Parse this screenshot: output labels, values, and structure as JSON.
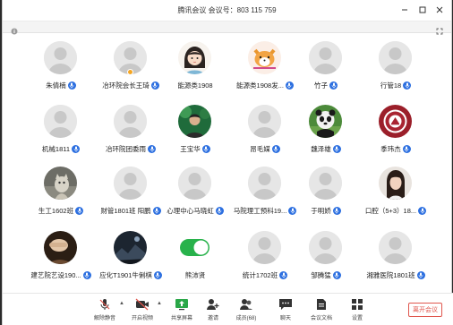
{
  "window": {
    "title": "腾讯会议  会议号：803 115 759"
  },
  "participants": [
    {
      "name": "朱倩楠",
      "avatar": "default",
      "mic": true
    },
    {
      "name": "冶环院会长王琦",
      "avatar": "default",
      "mic": true,
      "host": true
    },
    {
      "name": "能源类1908",
      "avatar": "girl-cartoon",
      "mic": false
    },
    {
      "name": "能源类1908发...",
      "avatar": "corgi-cartoon",
      "mic": true
    },
    {
      "name": "竹子",
      "avatar": "default",
      "mic": true
    },
    {
      "name": "行管18",
      "avatar": "default",
      "mic": true
    },
    {
      "name": "机械1811",
      "avatar": "default",
      "mic": true
    },
    {
      "name": "冶环院团委雨",
      "avatar": "default",
      "mic": true
    },
    {
      "name": "王宝华",
      "avatar": "person-green",
      "mic": true
    },
    {
      "name": "昂毛媒",
      "avatar": "default",
      "mic": true
    },
    {
      "name": "魏泽雄",
      "avatar": "panda",
      "mic": true
    },
    {
      "name": "季玮杰",
      "avatar": "badge-logo",
      "mic": true
    },
    {
      "name": "生工1602班",
      "avatar": "cat-photo",
      "mic": true
    },
    {
      "name": "财管1801班 阳鹏",
      "avatar": "default",
      "mic": true
    },
    {
      "name": "心理中心马晓虹",
      "avatar": "default",
      "mic": true
    },
    {
      "name": "马院理工预科19...",
      "avatar": "default",
      "mic": true
    },
    {
      "name": "于明娇",
      "avatar": "default",
      "mic": true
    },
    {
      "name": "口腔（5+3）18...",
      "avatar": "woman-photo",
      "mic": true
    },
    {
      "name": "建艺院艺设190...",
      "avatar": "hand-photo",
      "mic": true
    },
    {
      "name": "应化T1901牛俐棋",
      "avatar": "dark-photo",
      "mic": true
    },
    {
      "name": "熊沛贤",
      "avatar": "toggle",
      "mic": false
    },
    {
      "name": "统计1702班",
      "avatar": "default",
      "mic": true
    },
    {
      "name": "邹腾猛",
      "avatar": "default",
      "mic": true
    },
    {
      "name": "湘雅医院1801班",
      "avatar": "default",
      "mic": true
    }
  ],
  "toolbar": {
    "mute": "解除静音",
    "video": "开启视频",
    "share": "共享屏幕",
    "invite": "邀请",
    "members": "成员(68)",
    "chat": "聊天",
    "docs": "会议文档",
    "settings": "设置",
    "leave": "离开会议"
  },
  "colors": {
    "accent": "#2c6fe0",
    "leave": "#e0564d",
    "toggle_on": "#28b24b"
  }
}
